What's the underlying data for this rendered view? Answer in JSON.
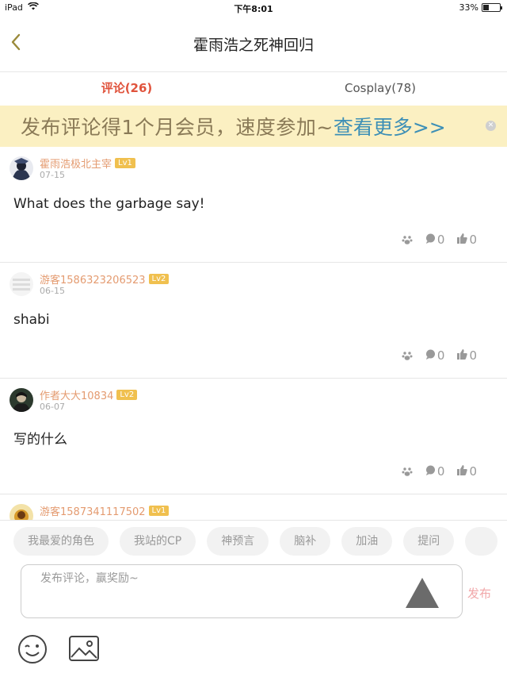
{
  "status_bar": {
    "device": "iPad",
    "time": "下午8:01",
    "battery": "33%",
    "battery_level": 0.33
  },
  "nav": {
    "title": "霍雨浩之死神回归",
    "back_icon": "chevron-left-icon"
  },
  "tabs": [
    {
      "label": "评论(26)",
      "active": true
    },
    {
      "label": "Cosplay(78)",
      "active": false
    }
  ],
  "banner": {
    "text": "发布评论得1个月会员，速度参加~",
    "link": "查看更多>>"
  },
  "comments": [
    {
      "user": "霍雨浩极北主宰",
      "level": "Lv1",
      "date": "07-15",
      "text": "What does the garbage say!",
      "comment_count": "0",
      "like_count": "0"
    },
    {
      "user": "游客1586323206523",
      "level": "Lv2",
      "date": "06-15",
      "text": "shabi",
      "comment_count": "0",
      "like_count": "0"
    },
    {
      "user": "作者大大10834",
      "level": "Lv2",
      "date": "06-07",
      "text": "写的什么",
      "comment_count": "0",
      "like_count": "0"
    },
    {
      "user": "游客1587341117502",
      "level": "Lv1",
      "date": "",
      "text": "",
      "comment_count": "",
      "like_count": ""
    }
  ],
  "quick_tags": [
    "我最爱的角色",
    "我站的CP",
    "神预言",
    "脑补",
    "加油",
    "提问"
  ],
  "composer": {
    "placeholder": "发布评论，赢奖励~",
    "send_label": "发布"
  },
  "colors": {
    "accent_red": "#e0533c",
    "username": "#e49b70",
    "level_badge": "#f0c04f",
    "banner_bg": "#fbf0c2",
    "banner_link": "#3d8fb6",
    "send": "#f1a7a9"
  }
}
